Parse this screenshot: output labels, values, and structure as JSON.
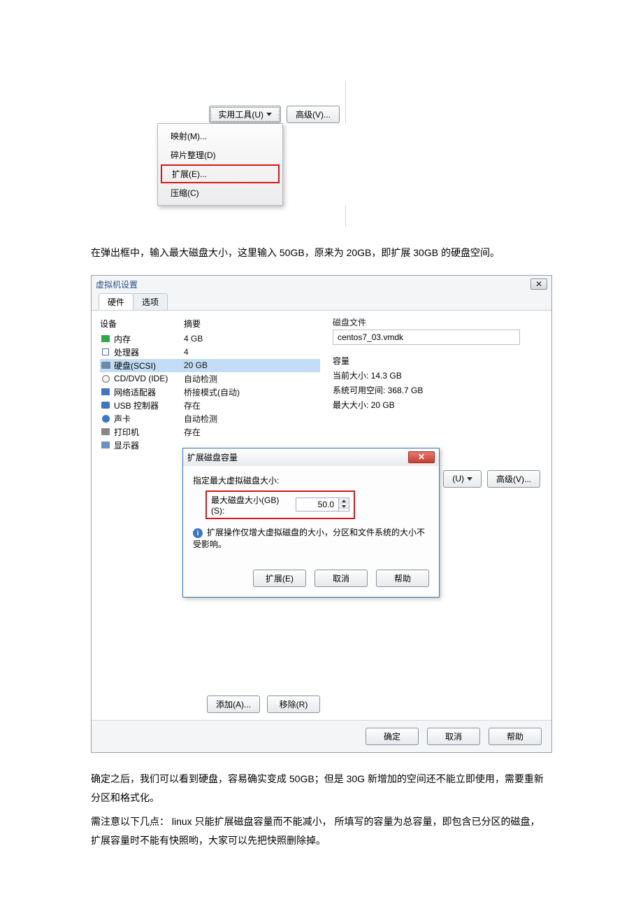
{
  "fig1": {
    "util_btn": "实用工具(U)",
    "adv_btn": "高级(V)...",
    "menu": {
      "map": "映射(M)...",
      "defrag": "碎片整理(D)",
      "expand": "扩展(E)...",
      "compress": "压缩(C)"
    }
  },
  "para1": "在弹出框中，输入最大磁盘大小，这里输入 50GB，原来为 20GB，即扩展 30GB 的硬盘空间。",
  "settings": {
    "title": "虚拟机设置",
    "close_glyph": "✕",
    "tabs": {
      "hardware": "硬件",
      "options": "选项"
    },
    "headers": {
      "device": "设备",
      "summary": "摘要"
    },
    "devices": [
      {
        "icon": "ic-mem",
        "name": "内存",
        "summary": "4 GB"
      },
      {
        "icon": "ic-cpu",
        "name": "处理器",
        "summary": "4"
      },
      {
        "icon": "ic-hdd",
        "name": "硬盘(SCSI)",
        "summary": "20 GB",
        "selected": true
      },
      {
        "icon": "ic-cd",
        "name": "CD/DVD (IDE)",
        "summary": "自动检测"
      },
      {
        "icon": "ic-nic",
        "name": "网络适配器",
        "summary": "桥接模式(自动)"
      },
      {
        "icon": "ic-usb",
        "name": "USB 控制器",
        "summary": "存在"
      },
      {
        "icon": "ic-snd",
        "name": "声卡",
        "summary": "自动检测"
      },
      {
        "icon": "ic-prn",
        "name": "打印机",
        "summary": "存在"
      },
      {
        "icon": "ic-disp",
        "name": "显示器",
        "summary": ""
      }
    ],
    "right": {
      "disk_file_label": "磁盘文件",
      "disk_file_value": "centos7_03.vmdk",
      "capacity_label": "容量",
      "cur_size": "当前大小: 14.3 GB",
      "sys_free": "系统可用空间: 368.7 GB",
      "max_size": "最大大小: 20 GB",
      "util_btn": "(U)",
      "adv_btn": "高级(V)..."
    },
    "modal": {
      "title": "扩展磁盘容量",
      "prompt": "指定最大虚拟磁盘大小:",
      "max_label": "最大磁盘大小(GB)(S):",
      "value": "50.0",
      "note": "扩展操作仅增大虚拟磁盘的大小，分区和文件系统的大小不受影响。",
      "btn_expand": "扩展(E)",
      "btn_cancel": "取消",
      "btn_help": "帮助"
    },
    "add_btn": "添加(A)...",
    "remove_btn": "移除(R)",
    "footer": {
      "ok": "确定",
      "cancel": "取消",
      "help": "帮助"
    }
  },
  "para2a": "确定之后，我们可以看到硬盘，容易确实变成 50GB；但是 30G 新增加的空间还不能立即使用，需要重新分区和格式化。",
  "para2b": "需注意以下几点：  linux 只能扩展磁盘容量而不能减小，  所填写的容量为总容量，即包含已分区的磁盘，  扩展容量时不能有快照哟，大家可以先把快照删除掉。"
}
